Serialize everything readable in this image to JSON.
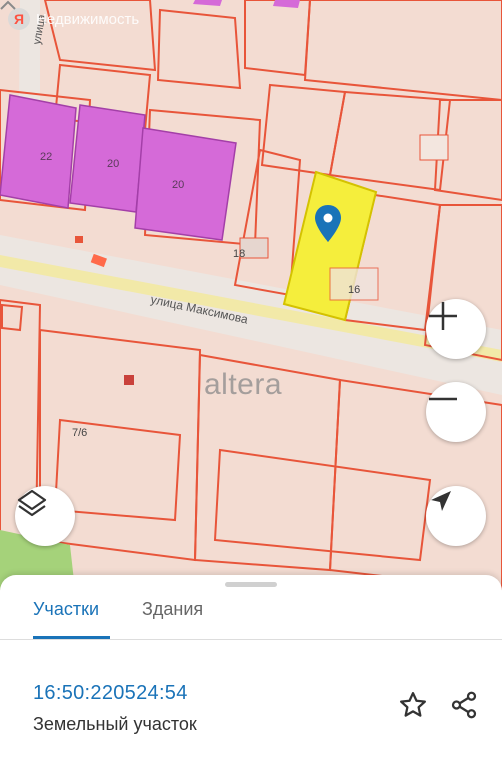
{
  "app": {
    "brand_label": "Недвижимость",
    "brand_letter": "Я",
    "watermark": "altera"
  },
  "map": {
    "street_name": "улица Максимова",
    "street_vertical": "улица",
    "house_numbers": [
      "22",
      "20",
      "20",
      "18",
      "16",
      "7/6"
    ],
    "highlight_color": "#f5ee3c",
    "building_color": "#d56ad8",
    "boundary_color": "#e8553a",
    "pin_color": "#1a73b8"
  },
  "controls": {
    "zoom_in_icon": "plus-icon",
    "zoom_out_icon": "minus-icon",
    "layers_icon": "layers-icon",
    "locate_icon": "navigation-arrow-icon"
  },
  "sheet": {
    "tabs": [
      {
        "label": "Участки",
        "active": true
      },
      {
        "label": "Здания",
        "active": false
      }
    ],
    "cadastral_number": "16:50:220524:54",
    "parcel_type": "Земельный участок",
    "favorite_icon": "star-icon",
    "share_icon": "share-icon"
  }
}
